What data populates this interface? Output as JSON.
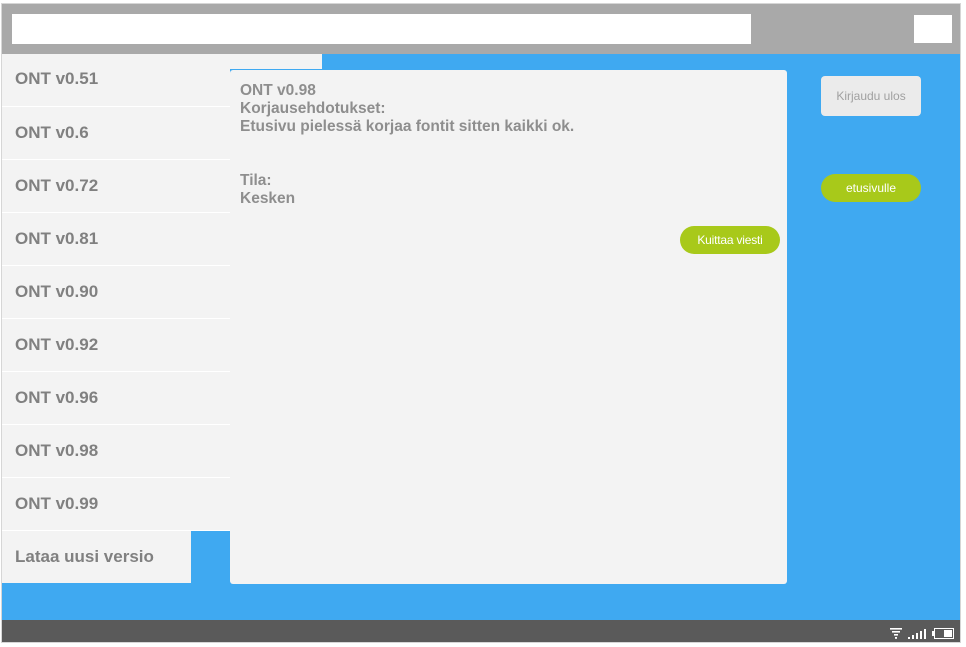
{
  "browser": {
    "url_value": "",
    "url_placeholder": ""
  },
  "sidebar": {
    "items": [
      {
        "label": "ONT v0.51"
      },
      {
        "label": "ONT v0.6"
      },
      {
        "label": "ONT v0.72"
      },
      {
        "label": "ONT v0.81"
      },
      {
        "label": "ONT v0.90"
      },
      {
        "label": "ONT v0.92"
      },
      {
        "label": "ONT v0.96"
      },
      {
        "label": "ONT v0.98"
      },
      {
        "label": "ONT v0.99"
      }
    ],
    "upload_label": "Lataa uusi versio"
  },
  "message": {
    "version": "ONT v0.98",
    "suggestions_heading": "Korjausehdotukset:",
    "suggestions_text": "Etusivu pielessä korjaa fontit sitten kaikki ok.",
    "status_heading": "Tila:",
    "status_value": "Kesken",
    "ack_button": "Kuittaa viesti"
  },
  "actions": {
    "logout_label": "Kirjaudu ulos",
    "home_label": "etusivulle"
  },
  "statusbar": {
    "icons": [
      "wifi-icon",
      "signal-icon",
      "battery-icon"
    ]
  },
  "colors": {
    "background_blue": "#3fa9f1",
    "accent_green": "#a8c91a",
    "panel_gray": "#f3f3f3",
    "topbar_gray": "#a9a9a9",
    "statusbar_gray": "#5a5a5a"
  }
}
